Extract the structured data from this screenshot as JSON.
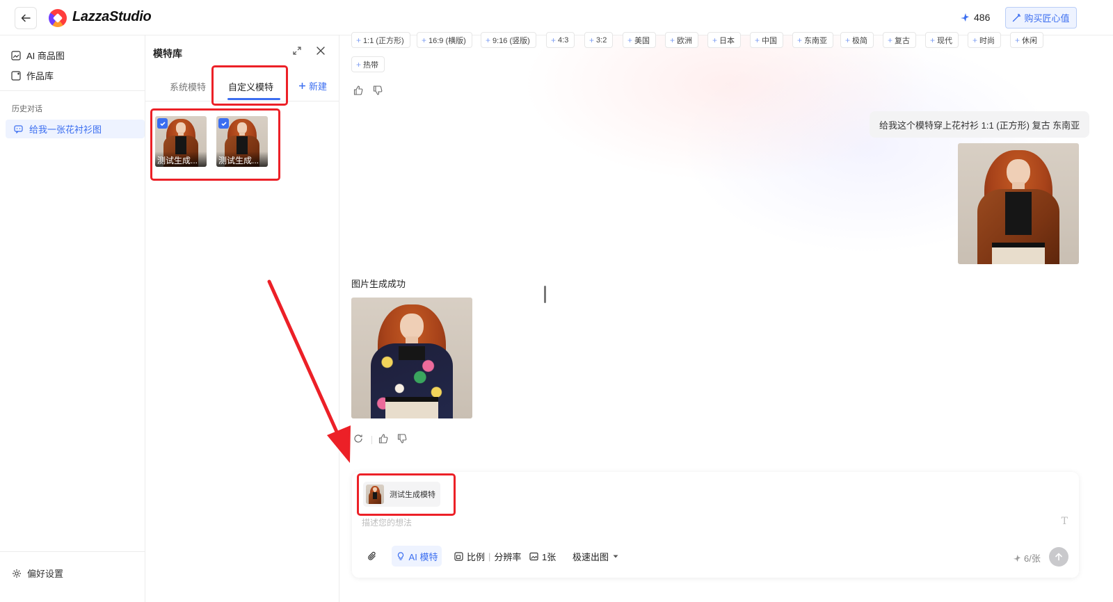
{
  "header": {
    "back_label": "←",
    "app_name": "LazzaStudio",
    "credits": "486",
    "buy_label": "购买匠心值"
  },
  "sidebar": {
    "nav": [
      {
        "label": "AI 商品图",
        "icon": "ai-image-icon"
      },
      {
        "label": "作品库",
        "icon": "gallery-icon"
      }
    ],
    "history_title": "历史对话",
    "history_items": [
      {
        "label": "给我一张花衬衫图",
        "icon": "chat-bubble-icon"
      }
    ],
    "settings_label": "偏好设置"
  },
  "model_panel": {
    "title": "模特库",
    "tabs": [
      "系统模特",
      "自定义模特"
    ],
    "active_tab": "自定义模特",
    "new_label": "新建",
    "models": [
      {
        "name": "测试生成...",
        "checked": true
      },
      {
        "name": "测试生成...",
        "checked": true
      }
    ]
  },
  "chat": {
    "tags": [
      "1:1 (正方形)",
      "16:9 (横版)",
      "9:16 (竖版)",
      "4:3",
      "3:2",
      "美国",
      "欧洲",
      "日本",
      "中国",
      "东南亚",
      "极简",
      "复古",
      "现代",
      "时尚",
      "休闲",
      "热带"
    ],
    "user_message": "给我这个模特穿上花衬衫 1:1 (正方形) 复古 东南亚",
    "bot_message": "图片生成成功"
  },
  "composer": {
    "attached_model": "测试生成模特",
    "placeholder": "描述您的想法",
    "font_icon": "T",
    "tools": {
      "ai_model": "AI 模特",
      "ratio": "比例",
      "resolution": "分辨率",
      "count": "1张",
      "speed": "极速出图"
    },
    "quota": "6/张"
  },
  "colors": {
    "accent": "#3b6ef0",
    "annotation_red": "#ec2027"
  }
}
